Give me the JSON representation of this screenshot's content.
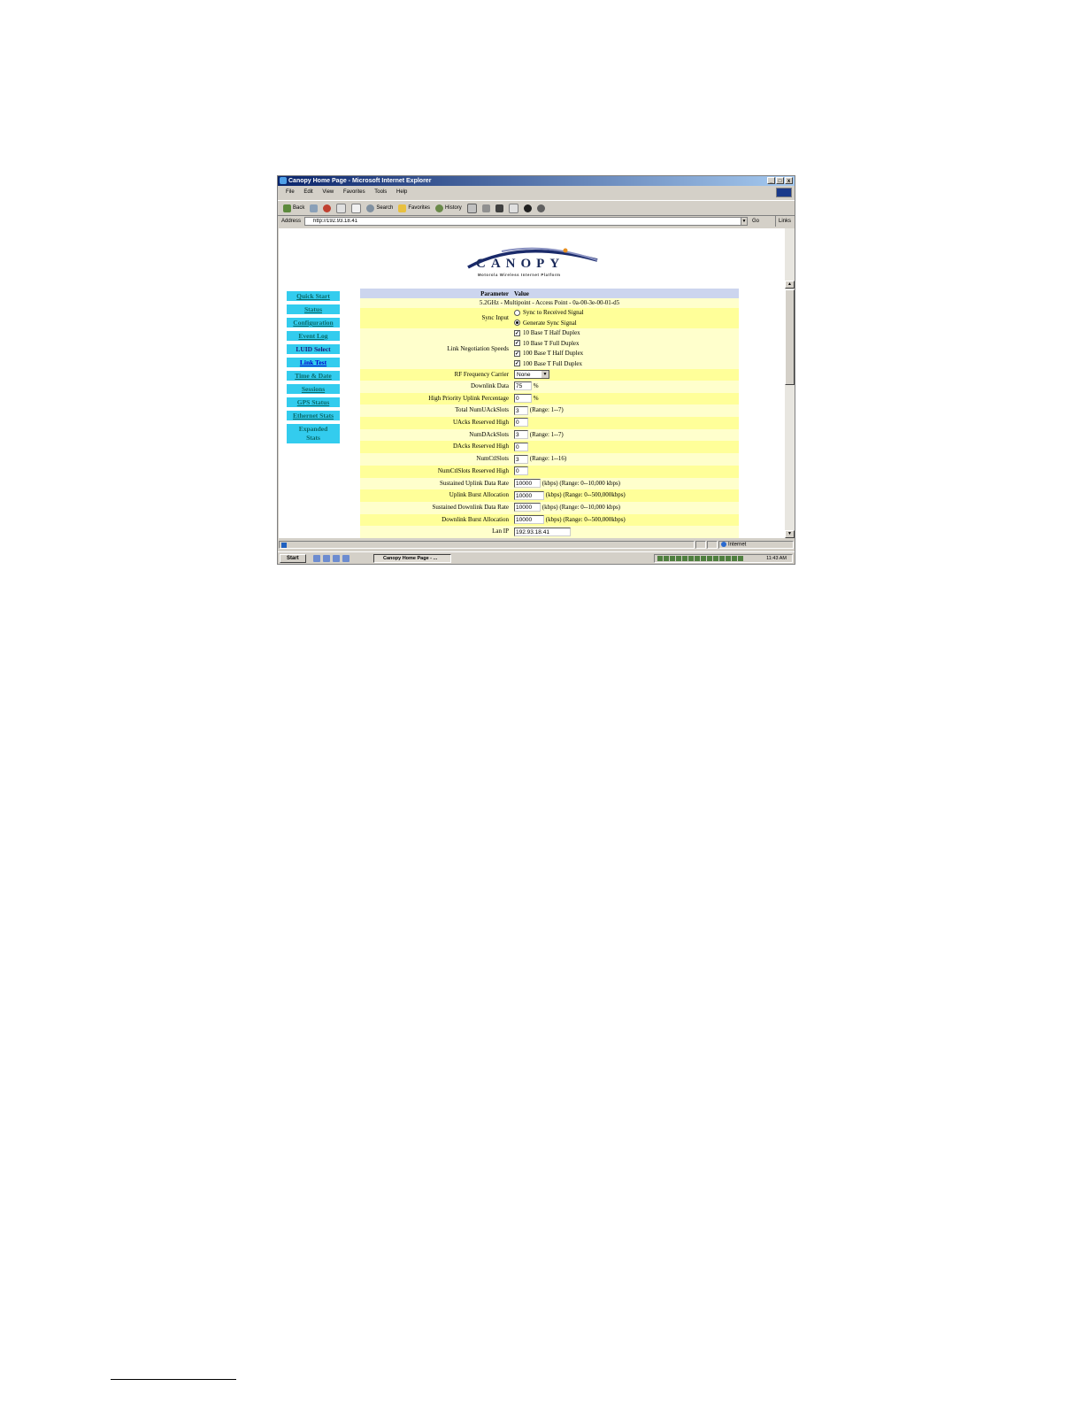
{
  "window": {
    "title": "Canopy Home Page - Microsoft Internet Explorer",
    "controls": [
      "_",
      "□",
      "x"
    ]
  },
  "menu": [
    "File",
    "Edit",
    "View",
    "Favorites",
    "Tools",
    "Help"
  ],
  "toolbar": {
    "back": "Back",
    "search": "Search",
    "favorites": "Favorites",
    "history": "History"
  },
  "address": {
    "label": "Address",
    "url": "http://192.93.18.41",
    "go": "Go",
    "links": "Links"
  },
  "logo": {
    "word": "CANOPY",
    "tagline": "Motorola Wireless Internet Platform"
  },
  "nav": [
    "Quick Start",
    "Status",
    "Configuration",
    "Event Log",
    "LUID Select",
    "Link Test",
    "Time & Date",
    "Sessions",
    "GPS Status",
    "Ethernet Stats",
    "Expanded Stats"
  ],
  "table": {
    "header": {
      "param": "Parameter",
      "value": "Value"
    },
    "device": "5.2GHz - Multipoint - Access Point - 0a-00-3e-00-01-d5",
    "sync_input": {
      "label": "Sync Input",
      "options": [
        "Sync to Received Signal",
        "Generate Sync Signal"
      ]
    },
    "link_negotiation": {
      "label": "Link Negotiation Speeds",
      "options": [
        "10 Base T Half Duplex",
        "10 Base T Full Duplex",
        "100 Base T Half Duplex",
        "100 Base T Full Duplex"
      ]
    },
    "rf_carrier": {
      "label": "RF Frequency Carrier",
      "value": "None"
    },
    "rows": [
      {
        "label": "Downlink Data",
        "value": "75",
        "suffix": "%"
      },
      {
        "label": "High Priority Uplink Percentage",
        "value": "0",
        "suffix": "%"
      },
      {
        "label": "Total NumUAckSlots",
        "value": "3",
        "suffix": "(Range: 1--7)"
      },
      {
        "label": "UAcks Reserved High",
        "value": "0",
        "suffix": ""
      },
      {
        "label": "NumDAckSlots",
        "value": "3",
        "suffix": "(Range: 1--7)"
      },
      {
        "label": "DAcks Reserved High",
        "value": "0",
        "suffix": ""
      },
      {
        "label": "NumCtlSlots",
        "value": "3",
        "suffix": "(Range: 1--16)"
      },
      {
        "label": "NumCtlSlots Reserved High",
        "value": "0",
        "suffix": ""
      },
      {
        "label": "Sustained Uplink Data Rate",
        "value": "10000",
        "suffix": "(kbps) (Range: 0--10,000 kbps)"
      },
      {
        "label": "Uplink Burst Allocation",
        "value": "10000",
        "suffix": "(kbps) (Range: 0--500,000kbps)"
      },
      {
        "label": "Sustained Downlink Data Rate",
        "value": "10000",
        "suffix": "(kbps) (Range: 0--10,000 kbps)"
      },
      {
        "label": "Downlink Burst Allocation",
        "value": "10000",
        "suffix": "(kbps) (Range: 0--500,000kbps)"
      },
      {
        "label": "Lan IP",
        "value": "192.93.18.41",
        "suffix": ""
      }
    ]
  },
  "status": {
    "zone": "Internet"
  },
  "taskbar": {
    "start": "Start",
    "task": "Canopy Home Page - ...",
    "clock": "11:43 AM"
  }
}
